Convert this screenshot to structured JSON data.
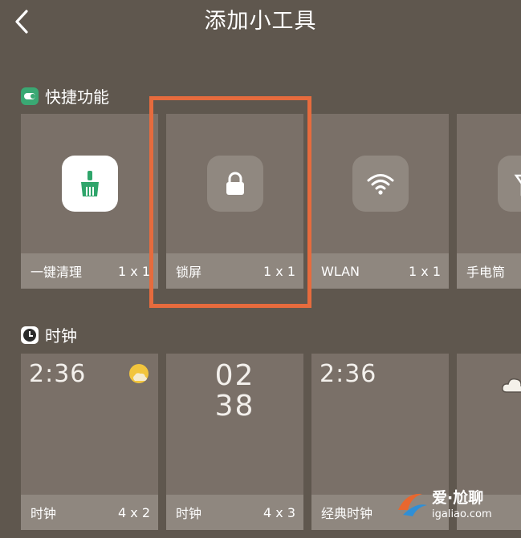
{
  "header": {
    "title": "添加小工具"
  },
  "sections": [
    {
      "title": "快捷功能",
      "cards": [
        {
          "label": "一键清理",
          "size": "1 x 1"
        },
        {
          "label": "锁屏",
          "size": "1 x 1"
        },
        {
          "label": "WLAN",
          "size": "1 x 1"
        },
        {
          "label": "手电筒",
          "size": ""
        }
      ]
    },
    {
      "title": "时钟",
      "cards": [
        {
          "label": "时钟",
          "size": "4 x 2",
          "time": "2:36"
        },
        {
          "label": "时钟",
          "size": "4 x 3",
          "hour": "02",
          "minute": "38"
        },
        {
          "label": "经典时钟",
          "size": "",
          "time": "2:36"
        },
        {
          "label": "",
          "size": ""
        }
      ]
    }
  ],
  "watermark": {
    "name": "爱·尬聊",
    "site": "igaliao.com"
  },
  "colors": {
    "background": "#5f574e",
    "card": "#7a7068",
    "footer": "#8f877f",
    "highlight": "#e66b3d",
    "accent_green": "#3aa873"
  }
}
